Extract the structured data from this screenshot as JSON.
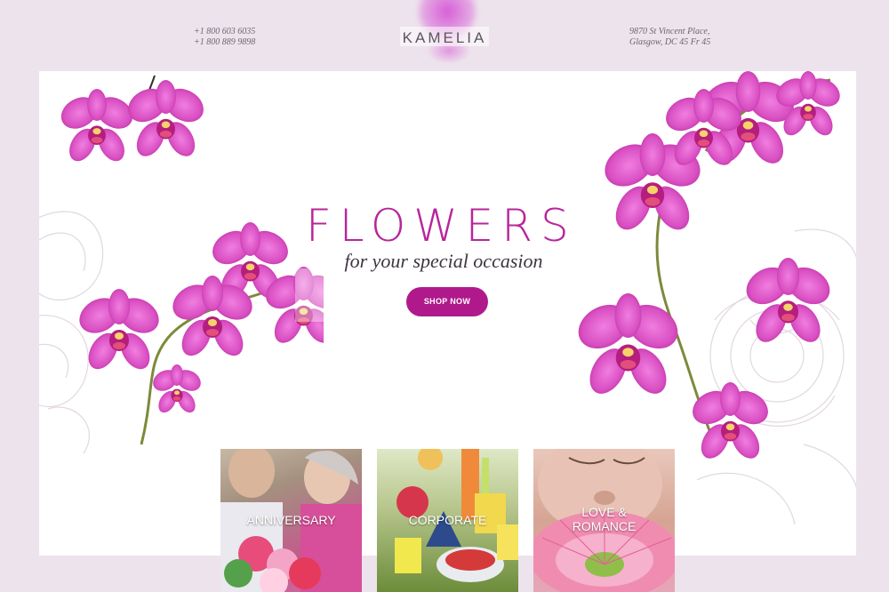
{
  "header": {
    "phone_1": "+1 800 603 6035",
    "phone_2": "+1 800 889 9898",
    "logo": "KAMELIA",
    "address_1": "9870 St Vincent Place,",
    "address_2": "Glasgow, DC 45 Fr 45"
  },
  "hero": {
    "title": "FLOWERS",
    "subtitle": "for your special occasion",
    "cta": "SHOP NOW"
  },
  "categories": [
    {
      "label": "ANNIVERSARY"
    },
    {
      "label": "CORPORATE"
    },
    {
      "label_line1": "LOVE &",
      "label_line2": "ROMANCE"
    }
  ],
  "colors": {
    "accent": "#b0198c",
    "orchid": "#d94fc2",
    "page_bg": "#ede3ec",
    "text": "#5c5560"
  }
}
